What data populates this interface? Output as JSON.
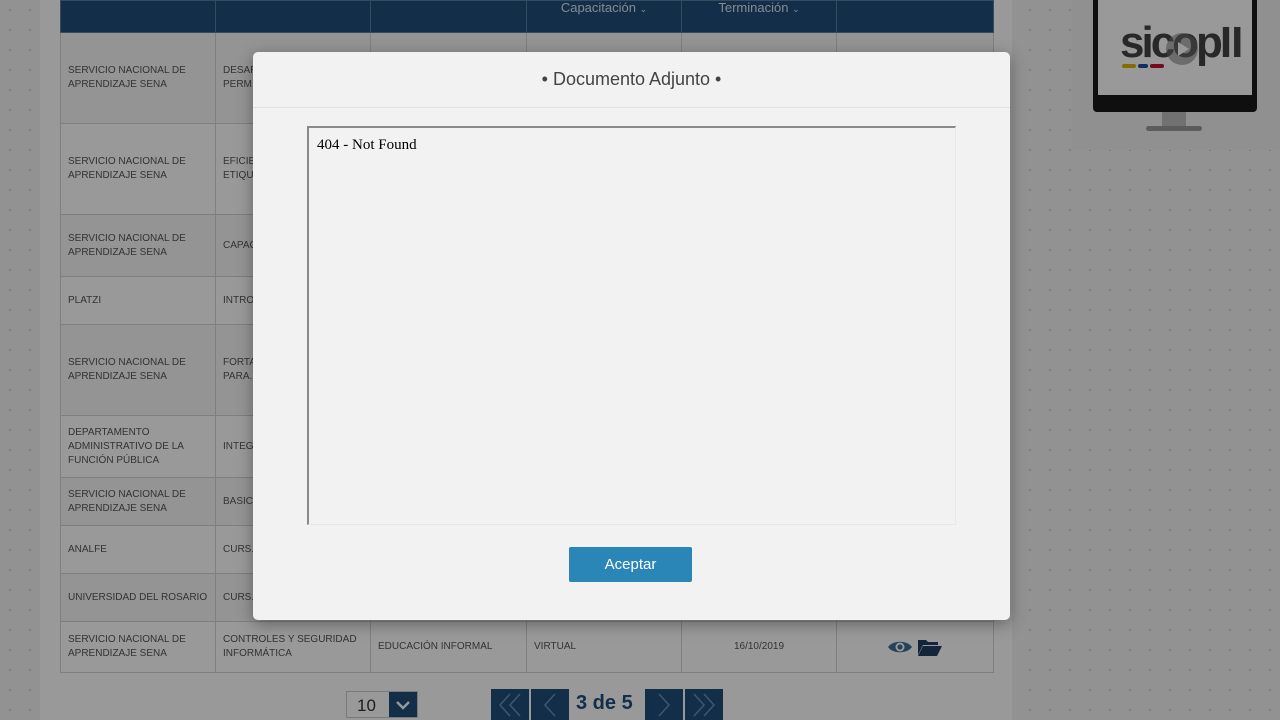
{
  "table": {
    "headers": [
      "",
      "",
      "",
      "Capacitación",
      "Terminación",
      ""
    ],
    "rows": [
      {
        "institution": "SERVICIO NACIONAL DE APRENDIZAJE SENA",
        "program": "DESARROLLO DE CAPAC... PERM... DESAR... CAMB...",
        "type": "",
        "modality": "",
        "end_date": ""
      },
      {
        "institution": "SERVICIO NACIONAL DE APRENDIZAJE SENA",
        "program": "EFICIE... CON É... CLASI... ETIQU... ENERG...",
        "type": "",
        "modality": "",
        "end_date": ""
      },
      {
        "institution": "SERVICIO NACIONAL DE APRENDIZAJE SENA",
        "program": "CAPAC... ADMIN... EDUCA...",
        "type": "",
        "modality": "",
        "end_date": ""
      },
      {
        "institution": "PLATZI",
        "program": "INTRO... INGEN...",
        "type": "",
        "modality": "",
        "end_date": ""
      },
      {
        "institution": "SERVICIO NACIONAL DE APRENDIZAJE SENA",
        "program": "FORTA... COMP... DIDÁC... PARA... PROY...",
        "type": "",
        "modality": "",
        "end_date": ""
      },
      {
        "institution": "DEPARTAMENTO ADMINISTRATIVO DE LA FUNCIÓN PÚBLICA",
        "program": "INTEG... TRANS... CONT...",
        "type": "",
        "modality": "",
        "end_date": ""
      },
      {
        "institution": "SERVICIO NACIONAL DE APRENDIZAJE SENA",
        "program": "BASIC...",
        "type": "",
        "modality": "",
        "end_date": ""
      },
      {
        "institution": "ANALFE",
        "program": "CURS... ECON...",
        "type": "",
        "modality": "",
        "end_date": ""
      },
      {
        "institution": "UNIVERSIDAD DEL ROSARIO",
        "program": "CURS... INFOR...",
        "type": "",
        "modality": "",
        "end_date": ""
      },
      {
        "institution": "SERVICIO NACIONAL DE APRENDIZAJE SENA",
        "program": "CONTROLES Y SEGURIDAD INFORMÁTICA",
        "type": "EDUCACIÓN INFORMAL",
        "modality": "VIRTUAL",
        "end_date": "16/10/2019"
      }
    ]
  },
  "logo": {
    "text": "sicop II",
    "icon": "play-icon"
  },
  "pagination": {
    "page_size": "10",
    "indicator": "3 de 5"
  },
  "modal": {
    "title": "• Documento Adjunto •",
    "frame_content": "404 - Not Found",
    "accept_label": "Aceptar"
  },
  "colors": {
    "header_bg": "#1f4e79",
    "accept_button": "#2a86b6",
    "icon_eye": "#3d6f97",
    "icon_folder": "#1f3f63"
  }
}
